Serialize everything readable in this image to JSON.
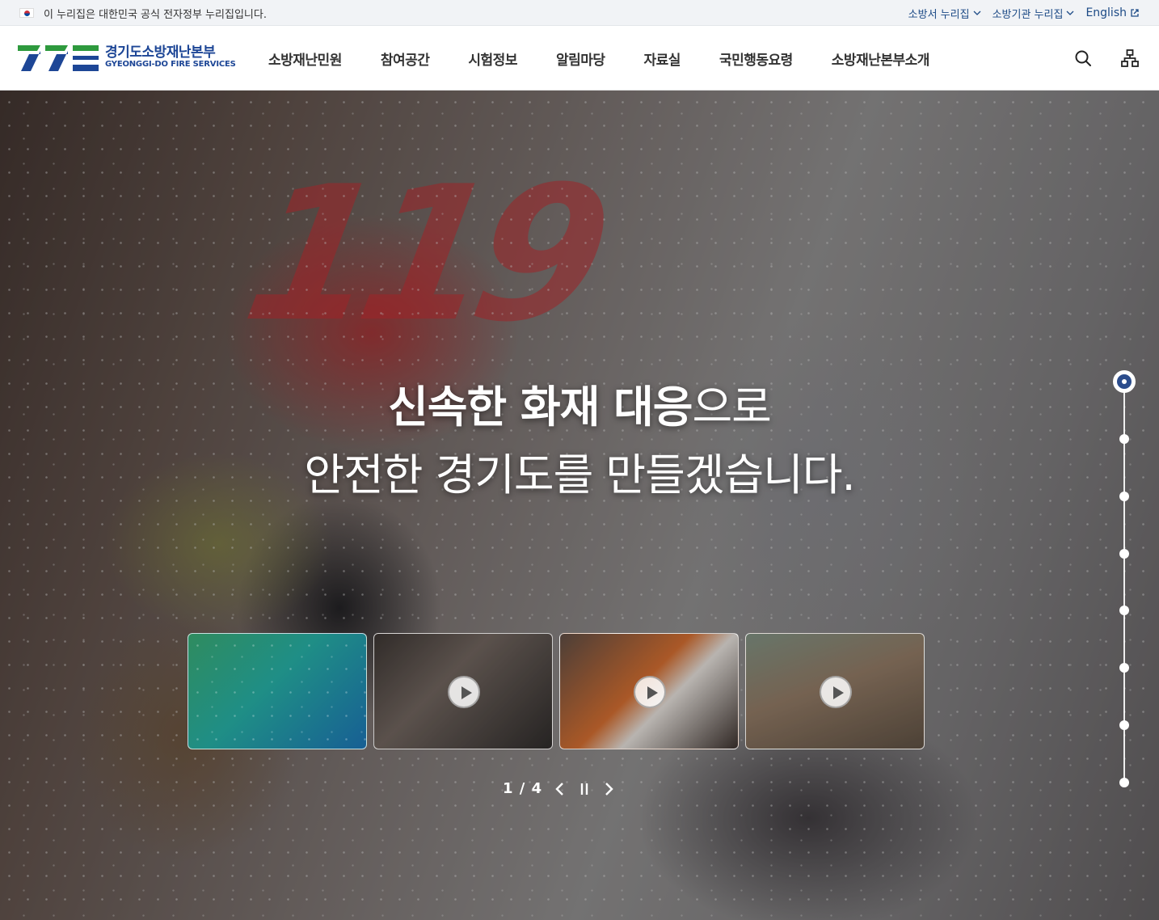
{
  "gov_bar": {
    "notice": "이 누리집은 대한민국 공식 전자정부 누리집입니다.",
    "links": [
      {
        "label": "소방서 누리집"
      },
      {
        "label": "소방기관 누리집"
      }
    ],
    "english": "English"
  },
  "header": {
    "logo_ko": "경기도소방재난본부",
    "logo_en": "GYEONGGI-DO FIRE SERVICES",
    "nav": [
      "소방재난민원",
      "참여공간",
      "시험정보",
      "알림마당",
      "자료실",
      "국민행동요령",
      "소방재난본부소개"
    ],
    "tools": [
      "search-icon",
      "sitemap-icon"
    ]
  },
  "hero": {
    "deco_text": "119",
    "line1_bold": "신속한 화재 대응",
    "line1_light": "으로",
    "line2": "안전한 경기도를 만들겠습니다.",
    "slide_counter": "1 / 4",
    "indicator_count": 8,
    "indicator_active": 1
  },
  "colors": {
    "brand_blue": "#1d4696",
    "brand_green": "#2e9a3e",
    "gov_bar_bg": "#f1f3f6",
    "indicator_active": "#2b4c8c"
  }
}
